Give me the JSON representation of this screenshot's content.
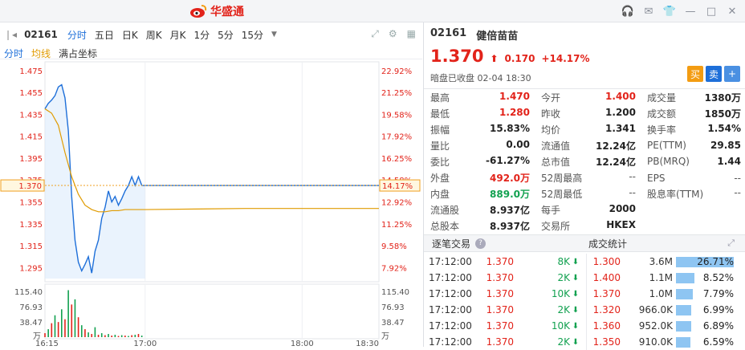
{
  "app": {
    "brand": "华盛通"
  },
  "window_icons": [
    "headset-icon",
    "mail-icon",
    "shirt-icon",
    "minimize-icon",
    "maximize-icon",
    "close-icon"
  ],
  "toolbar": {
    "code": "02161",
    "tabs": [
      "分时",
      "五日",
      "日K",
      "周K",
      "月K",
      "1分",
      "5分",
      "15分"
    ],
    "active": "分时"
  },
  "subbar": {
    "a": "分时",
    "b": "均线",
    "c": "满占坐标"
  },
  "colors": {
    "up": "#e2231a",
    "down": "#12a150",
    "price_line": "#1e6fd9",
    "avg_line": "#e09b00",
    "accent_blue": "#1e6fd9"
  },
  "chart_data": {
    "type": "line",
    "title": "",
    "x_labels": [
      "16:15",
      "17:00",
      "18:00",
      "18:30"
    ],
    "y_price_ticks": [
      1.475,
      1.455,
      1.435,
      1.415,
      1.395,
      1.375,
      1.355,
      1.335,
      1.315,
      1.295
    ],
    "y_pct_ticks": [
      "22.92%",
      "21.25%",
      "19.58%",
      "17.92%",
      "16.25%",
      "14.58%",
      "12.92%",
      "11.25%",
      "9.58%",
      "7.92%"
    ],
    "ylim": [
      1.285,
      1.48
    ],
    "current_price": 1.37,
    "current_price_label": "1.370",
    "current_pct_label": "14.17%",
    "price_series": [
      {
        "x": 0,
        "y": 1.44
      },
      {
        "x": 1,
        "y": 1.445
      },
      {
        "x": 2,
        "y": 1.448
      },
      {
        "x": 3,
        "y": 1.452
      },
      {
        "x": 4,
        "y": 1.46
      },
      {
        "x": 5,
        "y": 1.462
      },
      {
        "x": 6,
        "y": 1.45
      },
      {
        "x": 7,
        "y": 1.42
      },
      {
        "x": 8,
        "y": 1.36
      },
      {
        "x": 9,
        "y": 1.32
      },
      {
        "x": 10,
        "y": 1.3
      },
      {
        "x": 11,
        "y": 1.292
      },
      {
        "x": 12,
        "y": 1.298
      },
      {
        "x": 13,
        "y": 1.305
      },
      {
        "x": 14,
        "y": 1.29
      },
      {
        "x": 15,
        "y": 1.31
      },
      {
        "x": 16,
        "y": 1.32
      },
      {
        "x": 17,
        "y": 1.34
      },
      {
        "x": 18,
        "y": 1.35
      },
      {
        "x": 19,
        "y": 1.365
      },
      {
        "x": 20,
        "y": 1.355
      },
      {
        "x": 21,
        "y": 1.36
      },
      {
        "x": 22,
        "y": 1.352
      },
      {
        "x": 23,
        "y": 1.358
      },
      {
        "x": 24,
        "y": 1.365
      },
      {
        "x": 25,
        "y": 1.37
      },
      {
        "x": 26,
        "y": 1.378
      },
      {
        "x": 27,
        "y": 1.37
      },
      {
        "x": 28,
        "y": 1.378
      },
      {
        "x": 29,
        "y": 1.37
      },
      {
        "x": 30,
        "y": 1.37
      }
    ],
    "avg_series": [
      {
        "x": 0,
        "y": 1.44
      },
      {
        "x": 2,
        "y": 1.436
      },
      {
        "x": 4,
        "y": 1.425
      },
      {
        "x": 6,
        "y": 1.4
      },
      {
        "x": 8,
        "y": 1.378
      },
      {
        "x": 10,
        "y": 1.362
      },
      {
        "x": 12,
        "y": 1.352
      },
      {
        "x": 14,
        "y": 1.348
      },
      {
        "x": 16,
        "y": 1.346
      },
      {
        "x": 18,
        "y": 1.346
      },
      {
        "x": 20,
        "y": 1.347
      },
      {
        "x": 22,
        "y": 1.347
      },
      {
        "x": 24,
        "y": 1.348
      },
      {
        "x": 26,
        "y": 1.348
      },
      {
        "x": 28,
        "y": 1.348
      },
      {
        "x": 30,
        "y": 1.348
      },
      {
        "x": 60,
        "y": 1.349
      },
      {
        "x": 100,
        "y": 1.349
      }
    ],
    "x_max": 100,
    "volume_ticks": [
      "115.40",
      "76.93",
      "38.47"
    ],
    "volume_unit": "万",
    "volume_max": 125,
    "volume_bars": [
      {
        "x": 0,
        "v": 10,
        "c": "up"
      },
      {
        "x": 1,
        "v": 20,
        "c": "down"
      },
      {
        "x": 2,
        "v": 35,
        "c": "up"
      },
      {
        "x": 3,
        "v": 55,
        "c": "down"
      },
      {
        "x": 4,
        "v": 38,
        "c": "up"
      },
      {
        "x": 5,
        "v": 70,
        "c": "down"
      },
      {
        "x": 6,
        "v": 45,
        "c": "up"
      },
      {
        "x": 7,
        "v": 118,
        "c": "down"
      },
      {
        "x": 8,
        "v": 82,
        "c": "up"
      },
      {
        "x": 9,
        "v": 95,
        "c": "down"
      },
      {
        "x": 10,
        "v": 50,
        "c": "up"
      },
      {
        "x": 11,
        "v": 30,
        "c": "down"
      },
      {
        "x": 12,
        "v": 20,
        "c": "up"
      },
      {
        "x": 13,
        "v": 12,
        "c": "down"
      },
      {
        "x": 14,
        "v": 8,
        "c": "up"
      },
      {
        "x": 15,
        "v": 25,
        "c": "down"
      },
      {
        "x": 16,
        "v": 6,
        "c": "up"
      },
      {
        "x": 17,
        "v": 10,
        "c": "down"
      },
      {
        "x": 18,
        "v": 5,
        "c": "up"
      },
      {
        "x": 19,
        "v": 8,
        "c": "down"
      },
      {
        "x": 20,
        "v": 4,
        "c": "up"
      },
      {
        "x": 21,
        "v": 6,
        "c": "down"
      },
      {
        "x": 22,
        "v": 3,
        "c": "up"
      },
      {
        "x": 23,
        "v": 5,
        "c": "down"
      },
      {
        "x": 24,
        "v": 4,
        "c": "up"
      },
      {
        "x": 25,
        "v": 3,
        "c": "down"
      },
      {
        "x": 26,
        "v": 5,
        "c": "up"
      },
      {
        "x": 27,
        "v": 6,
        "c": "down"
      },
      {
        "x": 28,
        "v": 8,
        "c": "up"
      },
      {
        "x": 29,
        "v": 4,
        "c": "down"
      }
    ]
  },
  "stock": {
    "code": "02161",
    "name": "健倍苗苗",
    "price": "1.370",
    "change": "0.170",
    "change_pct": "+14.17%",
    "status": "暗盘已收盘 02-04 18:30"
  },
  "trade_buttons": {
    "buy": "买",
    "sell": "卖",
    "add": "+"
  },
  "stats": [
    [
      [
        "最高",
        "1.470",
        "red"
      ],
      [
        "今开",
        "1.400",
        "red"
      ],
      [
        "成交量",
        "1380万",
        ""
      ]
    ],
    [
      [
        "最低",
        "1.280",
        "red"
      ],
      [
        "昨收",
        "1.200",
        ""
      ],
      [
        "成交额",
        "1850万",
        ""
      ]
    ],
    [
      [
        "振幅",
        "15.83%",
        ""
      ],
      [
        "均价",
        "1.341",
        ""
      ],
      [
        "换手率",
        "1.54%",
        ""
      ]
    ],
    [
      [
        "量比",
        "0.00",
        ""
      ],
      [
        "流通值",
        "12.24亿",
        ""
      ],
      [
        "PE(TTM)",
        "29.85",
        ""
      ]
    ],
    [
      [
        "委比",
        "-61.27%",
        ""
      ],
      [
        "总市值",
        "12.24亿",
        ""
      ],
      [
        "PB(MRQ)",
        "1.44",
        ""
      ]
    ],
    [
      [
        "外盘",
        "492.0万",
        "red"
      ],
      [
        "52周最高",
        "--",
        "muted"
      ],
      [
        "EPS",
        "--",
        "muted"
      ]
    ],
    [
      [
        "内盘",
        "889.0万",
        "green"
      ],
      [
        "52周最低",
        "--",
        "muted"
      ],
      [
        "股息率(TTM)",
        "--",
        "muted"
      ]
    ],
    [
      [
        "流通股",
        "8.937亿",
        ""
      ],
      [
        "每手",
        "2000",
        ""
      ],
      [
        "",
        "",
        " "
      ]
    ],
    [
      [
        "总股本",
        "8.937亿",
        ""
      ],
      [
        "交易所",
        "HKEX",
        ""
      ],
      [
        "",
        "",
        " "
      ]
    ]
  ],
  "panel": {
    "left_title": "逐笔交易",
    "mid_title": "成交统计",
    "help": "?"
  },
  "ticks": [
    {
      "time": "17:12:00",
      "price": "1.370",
      "vol": "8K"
    },
    {
      "time": "17:12:00",
      "price": "1.370",
      "vol": "2K"
    },
    {
      "time": "17:12:00",
      "price": "1.370",
      "vol": "10K"
    },
    {
      "time": "17:12:00",
      "price": "1.370",
      "vol": "2K"
    },
    {
      "time": "17:12:00",
      "price": "1.370",
      "vol": "10K"
    },
    {
      "time": "17:12:00",
      "price": "1.370",
      "vol": "2K"
    }
  ],
  "vol_stats": [
    {
      "price": "1.300",
      "vol": "3.6M",
      "pct": "26.71%",
      "frac": 1.0
    },
    {
      "price": "1.400",
      "vol": "1.1M",
      "pct": "8.52%",
      "frac": 0.32
    },
    {
      "price": "1.370",
      "vol": "1.0M",
      "pct": "7.79%",
      "frac": 0.29
    },
    {
      "price": "1.320",
      "vol": "966.0K",
      "pct": "6.99%",
      "frac": 0.26
    },
    {
      "price": "1.360",
      "vol": "952.0K",
      "pct": "6.89%",
      "frac": 0.26
    },
    {
      "price": "1.350",
      "vol": "910.0K",
      "pct": "6.59%",
      "frac": 0.25
    }
  ]
}
